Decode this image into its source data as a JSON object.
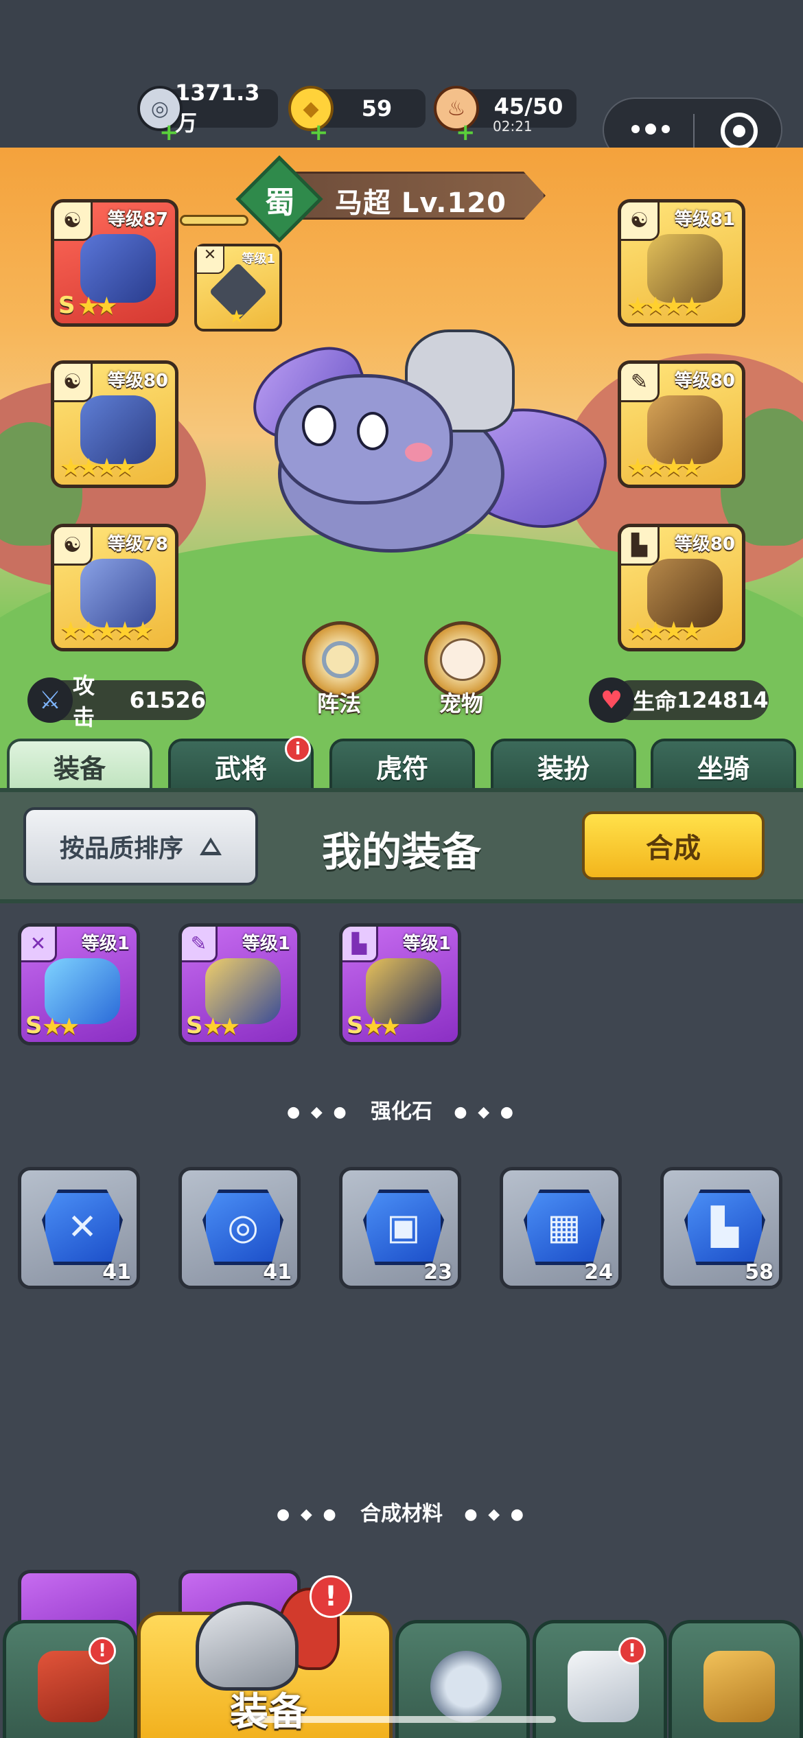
{
  "resources": {
    "silver": "1371.3万",
    "gold": "59",
    "stamina": "45/50",
    "stamina_timer": "02:21"
  },
  "hero": {
    "kingdom": "蜀",
    "name_level": "马超  Lv.120",
    "attack_label": "攻击",
    "attack_value": "61526",
    "hp_label": "生命",
    "hp_value": "124814"
  },
  "hero_slots": {
    "weapon_level": "等级87",
    "weapon_rank": "S",
    "small_level": "等级1",
    "armor_left_level": "等级80",
    "helmet_left_level": "等级78",
    "armor_right_level": "等级81",
    "belt_right_level": "等级80",
    "boots_right_level": "等级80"
  },
  "round_buttons": {
    "formation": "阵法",
    "pet": "宠物"
  },
  "tabs": [
    "装备",
    "武将",
    "虎符",
    "装扮",
    "坐骑"
  ],
  "tab_badge": "i",
  "panel": {
    "sort_label": "按品质排序",
    "title": "我的装备",
    "combine_label": "合成"
  },
  "equipment_items": [
    {
      "level": "等级1",
      "rank": "S"
    },
    {
      "level": "等级1",
      "rank": "S"
    },
    {
      "level": "等级1",
      "rank": "S"
    }
  ],
  "section_stones": "强化石",
  "stones": [
    {
      "count": "41",
      "icon": "sword-icon"
    },
    {
      "count": "41",
      "icon": "medal-icon"
    },
    {
      "count": "23",
      "icon": "helmet-icon"
    },
    {
      "count": "24",
      "icon": "armor-icon"
    },
    {
      "count": "58",
      "icon": "boot-icon"
    }
  ],
  "section_materials": "合成材料",
  "bottom_nav": {
    "active_label": "装备",
    "badge": "!"
  },
  "colors": {
    "tab_active": "#bfe3be",
    "item_purple": "#8b2fc4",
    "combine_yellow": "#f3b51c",
    "badge_red": "#e33a3a"
  }
}
